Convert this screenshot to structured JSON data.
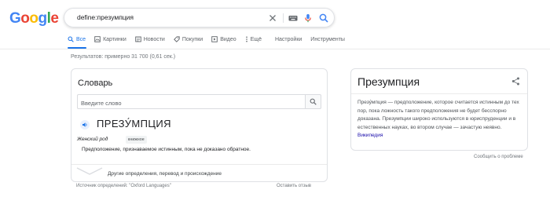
{
  "logo": {
    "letters": [
      "G",
      "o",
      "o",
      "g",
      "l",
      "e"
    ],
    "colors": [
      "#4285F4",
      "#EA4335",
      "#FBBC05",
      "#4285F4",
      "#34A853",
      "#EA4335"
    ]
  },
  "search": {
    "query": "define:презумпция"
  },
  "tabs": [
    {
      "label": "Все",
      "icon": "search-icon",
      "active": true
    },
    {
      "label": "Картинки",
      "icon": "image-icon",
      "active": false
    },
    {
      "label": "Новости",
      "icon": "news-icon",
      "active": false
    },
    {
      "label": "Покупки",
      "icon": "tag-icon",
      "active": false
    },
    {
      "label": "Видео",
      "icon": "play-icon",
      "active": false
    },
    {
      "label": "Ещё",
      "icon": "more-vert-icon",
      "active": false
    },
    {
      "label": "Настройки",
      "icon": "",
      "active": false
    },
    {
      "label": "Инструменты",
      "icon": "",
      "active": false
    }
  ],
  "result_stats": "Результатов: примерно 31 700 (0,61 сек.)",
  "dictionary": {
    "title": "Словарь",
    "input_placeholder": "Введите слово",
    "headword": "ПРЕЗУ́МПЦИЯ",
    "part_of_speech": "Женский род",
    "badge": "книжное",
    "definition": "Предположение, признаваемое истинным, пока не доказано обратное.",
    "more_label": "Другие определения, перевод и происхождение",
    "source": "Источник определений: \"Oxford Languages\"",
    "feedback": "Оставить отзыв"
  },
  "knowledge_panel": {
    "title": "Презумпция",
    "description": "Презу́мпция — предположение, которое считается истинным до тех пор, пока ложность такого предположения не будет бесспорно доказана. Презумпции широко используются в юриспруденции и в естественных науках, во втором случае — зачастую неявно.",
    "link_text": "Википедия",
    "feedback": "Сообщить о проблеме"
  },
  "colors": {
    "accent": "#1a73e8",
    "link": "#1a0dab",
    "mic_blue": "#4285F4",
    "mic_red": "#EA4335"
  }
}
